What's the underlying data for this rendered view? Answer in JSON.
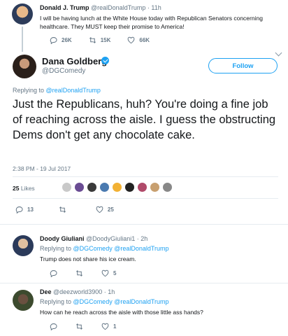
{
  "parent": {
    "name": "Donald J. Trump",
    "handle": "@realDonaldTrump",
    "dot": "·",
    "time": "11h",
    "text": "I will be having lunch at the White House today with Republican Senators concerning healthcare. They MUST keep their promise to America!",
    "replies": "26K",
    "retweets": "15K",
    "likes": "66K"
  },
  "main": {
    "name": "Dana Goldberg",
    "handle": "@DGComedy",
    "follow_label": "Follow",
    "replying_prefix": "Replying to",
    "replying_to": "@realDonaldTrump",
    "text": "Just the Republicans, huh? You're doing a fine job of reaching across the aisle. I guess the obstructing Dems don't get any chocolate cake.",
    "timestamp": "2:38 PM - 19 Jul 2017",
    "likes_count": "25",
    "likes_label": "Likes",
    "replies": "13",
    "retweets": "",
    "likes": "25"
  },
  "likers": [
    "#c9c9c9",
    "#6a4c93",
    "#3a3a3a",
    "#4a7ab0",
    "#f2b134",
    "#222222",
    "#b04a6a",
    "#c8a070",
    "#888888"
  ],
  "replies": [
    {
      "name": "Doody Giuliani",
      "handle": "@DoodyGiuliani1",
      "dot": "·",
      "time": "2h",
      "replying_prefix": "Replying to",
      "replying_to": "@DGComedy @realDonaldTrump",
      "text": "Trump does not share his ice cream.",
      "likes": "5"
    },
    {
      "name": "Dee",
      "handle": "@deezworld3900",
      "dot": "·",
      "time": "1h",
      "replying_prefix": "Replying to",
      "replying_to": "@DGComedy @realDonaldTrump",
      "text": "How can he reach across the aisle with those little ass hands?",
      "likes": "1"
    }
  ],
  "colors": {
    "accent": "#1da1f2",
    "muted": "#657786",
    "border": "#e6ecf0"
  }
}
